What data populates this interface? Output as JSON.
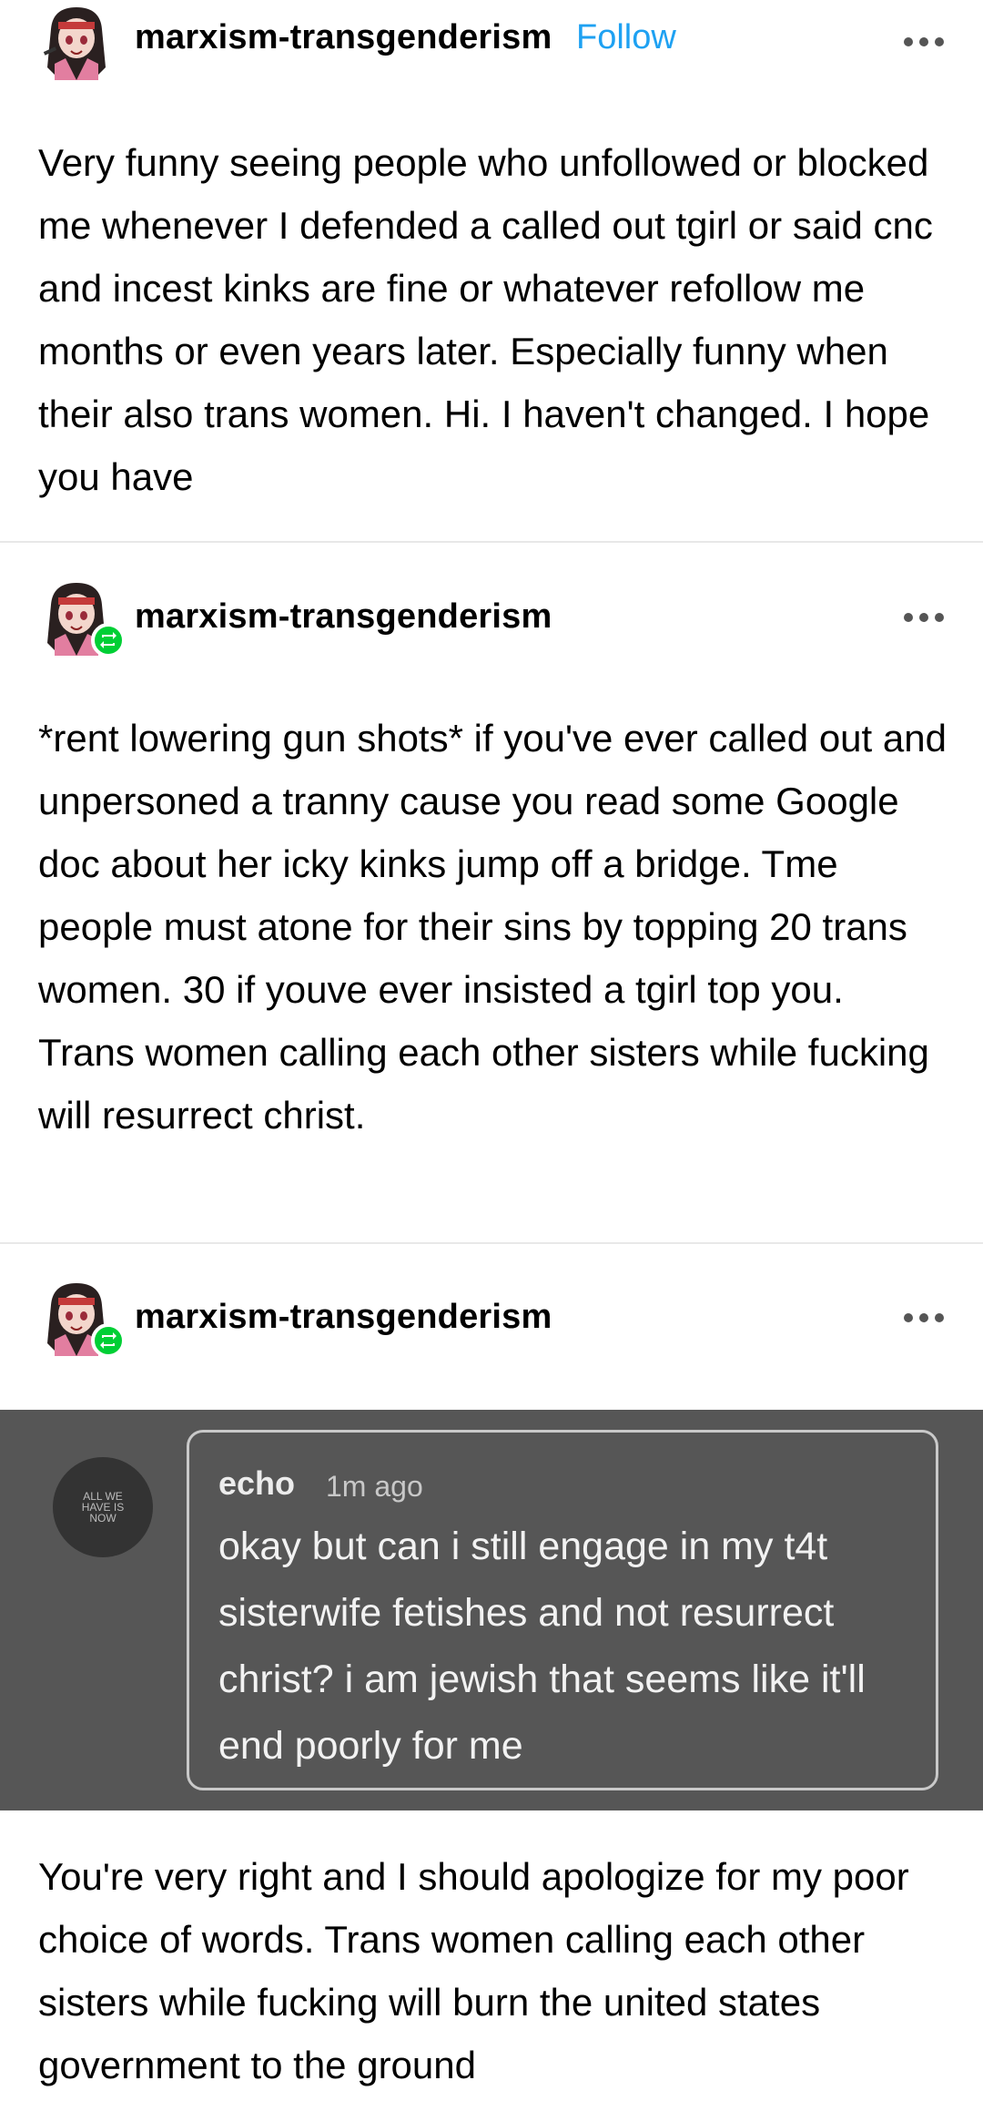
{
  "posts": [
    {
      "username": "marxism-transgenderism",
      "follow_label": "Follow",
      "body": "Very funny seeing people who unfollowed or blocked me whenever I defended a called out tgirl or said cnc and incest kinks are fine or whatever refollow me months or even years later. Especially funny when their also trans women. Hi. I haven't changed. I hope you have"
    },
    {
      "username": "marxism-transgenderism",
      "body": "*rent lowering gun shots* if you've ever called out and unpersoned a tranny cause you read some Google doc about her icky kinks jump off a bridge. Tme people must atone for their sins by topping 20 trans women. 30 if youve ever insisted a tgirl top you. Trans women calling each other sisters while fucking will resurrect christ."
    },
    {
      "username": "marxism-transgenderism",
      "screenshot": {
        "avatar_text": "ALL WE HAVE IS NOW",
        "name": "echo",
        "time": "1m ago",
        "message": "okay but can i still engage in my t4t sisterwife fetishes and not resurrect christ? i am jewish that seems like it'll end poorly for me"
      },
      "body": "You're very right and I should apologize for my poor choice of words. Trans women calling each other sisters while fucking will burn the united states government to the ground"
    }
  ],
  "colors": {
    "follow": "#1ea1f2",
    "reblog_badge": "#00cf35"
  },
  "icons": [
    "avatar",
    "reblog-icon",
    "more-options-icon"
  ]
}
